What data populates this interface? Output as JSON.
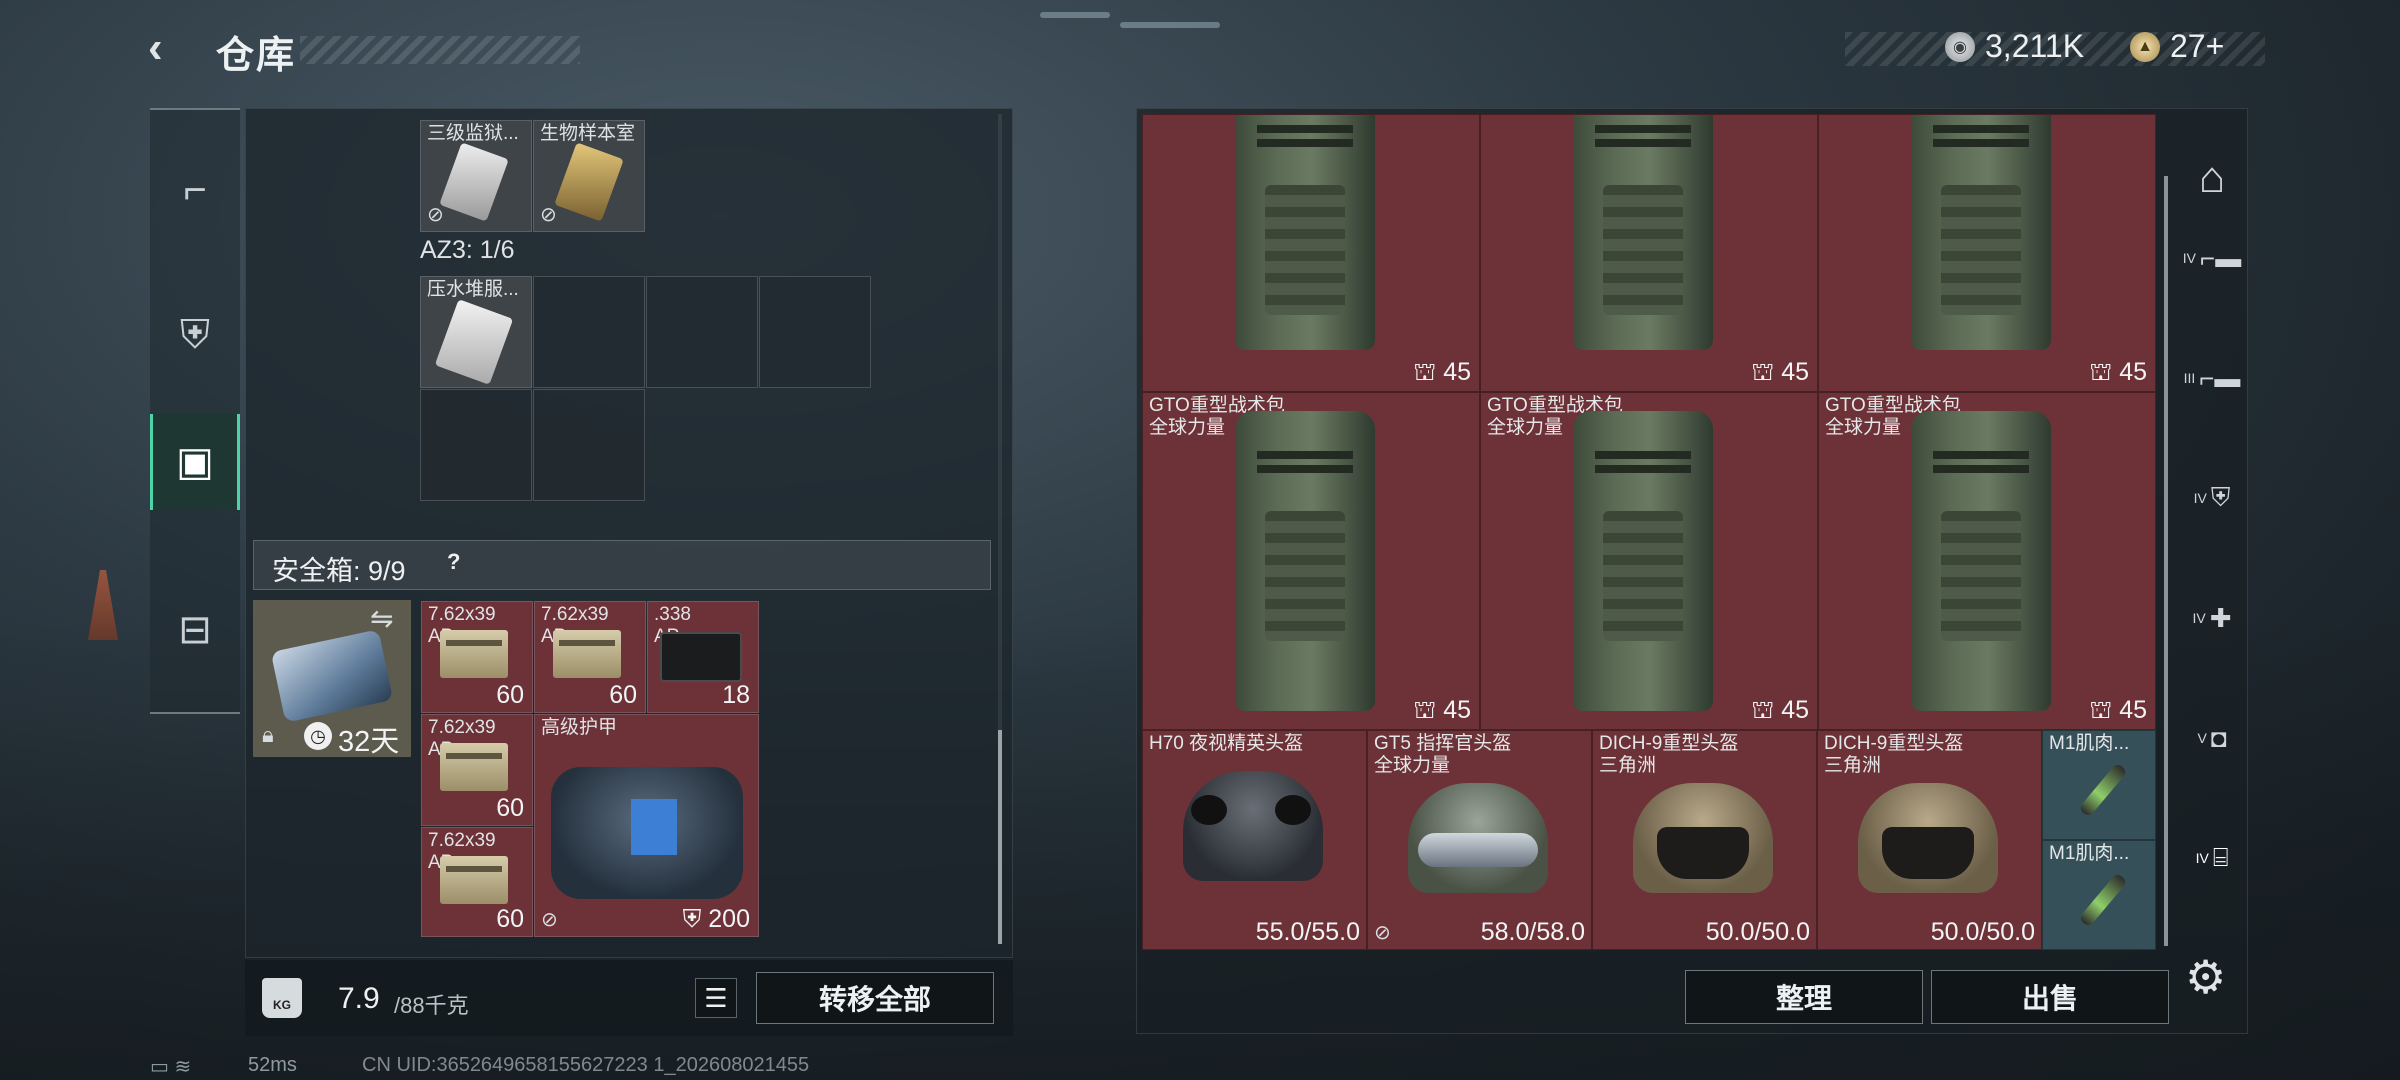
{
  "header": {
    "title": "仓库",
    "back_icon": "back-arrow-icon"
  },
  "currency": {
    "silver": "3,211K",
    "gold": "27+"
  },
  "left_nav": [
    {
      "icon": "pistol-icon"
    },
    {
      "icon": "armor-vest-icon"
    },
    {
      "icon": "backpack-icon",
      "active": true
    },
    {
      "icon": "briefcase-icon"
    }
  ],
  "storage": {
    "top_items": [
      {
        "label": "三级监狱..."
      },
      {
        "label": "生物样本室"
      }
    ],
    "az3": {
      "label": "AZ3: 1/6"
    },
    "az3_items": [
      {
        "label": "压水堆服..."
      }
    ]
  },
  "safe_box": {
    "label": "安全箱: 9/9",
    "help": "?",
    "days": "32天",
    "items": [
      {
        "label": "7.62x39",
        "sub": "AP",
        "count": "60"
      },
      {
        "label": "7.62x39",
        "sub": "AP",
        "count": "60"
      },
      {
        "label": ".338",
        "sub": "AP",
        "count": "18"
      },
      {
        "label": "7.62x39",
        "sub": "AP",
        "count": "60"
      },
      {
        "label": "7.62x39",
        "sub": "AP",
        "count": "60"
      },
      {
        "label": "高级护甲",
        "durability": "200"
      }
    ]
  },
  "footer_left": {
    "kg_badge": "KG",
    "weight": "7.9",
    "weight_max": "/88千克",
    "transfer_all": "转移全部"
  },
  "status": {
    "ping": "52ms",
    "uid": "CN UID:3652649658155627223 1_202608021455"
  },
  "backpacks_top": [
    {
      "count": "45"
    },
    {
      "count": "45"
    },
    {
      "count": "45"
    }
  ],
  "backpacks_mid": [
    {
      "name": "GTO重型战术包",
      "sub": "全球力量",
      "count": "45"
    },
    {
      "name": "GTO重型战术包",
      "sub": "全球力量",
      "count": "45"
    },
    {
      "name": "GTO重型战术包",
      "sub": "全球力量",
      "count": "45"
    }
  ],
  "helmets": [
    {
      "name": "H70 夜视精英头盔",
      "sub": "",
      "durability": "55.0/55.0"
    },
    {
      "name": "GT5 指挥官头盔",
      "sub": "全球力量",
      "durability": "58.0/58.0"
    },
    {
      "name": "DICH-9重型头盔",
      "sub": "三角洲",
      "durability": "50.0/50.0"
    },
    {
      "name": "DICH-9重型头盔",
      "sub": "三角洲",
      "durability": "50.0/50.0"
    }
  ],
  "syringes": [
    {
      "name": "M1肌肉..."
    },
    {
      "name": "M1肌肉..."
    }
  ],
  "right_tabs": [
    {
      "label": "",
      "icon": "all-items-icon"
    },
    {
      "label": "IV",
      "icon": "weapon-tier-icon"
    },
    {
      "label": "III",
      "icon": "weapon-tier-icon"
    },
    {
      "label": "IV",
      "icon": "armor-tier-icon"
    },
    {
      "label": "IV",
      "icon": "medical-tier-icon"
    },
    {
      "label": "V",
      "icon": "container-tier-icon"
    },
    {
      "label": "IV",
      "icon": "key-tier-icon"
    }
  ],
  "actions": {
    "sort": "整理",
    "sell": "出售"
  },
  "colors": {
    "cell_red": "#6d3238",
    "active_green": "#4bd5a8"
  }
}
